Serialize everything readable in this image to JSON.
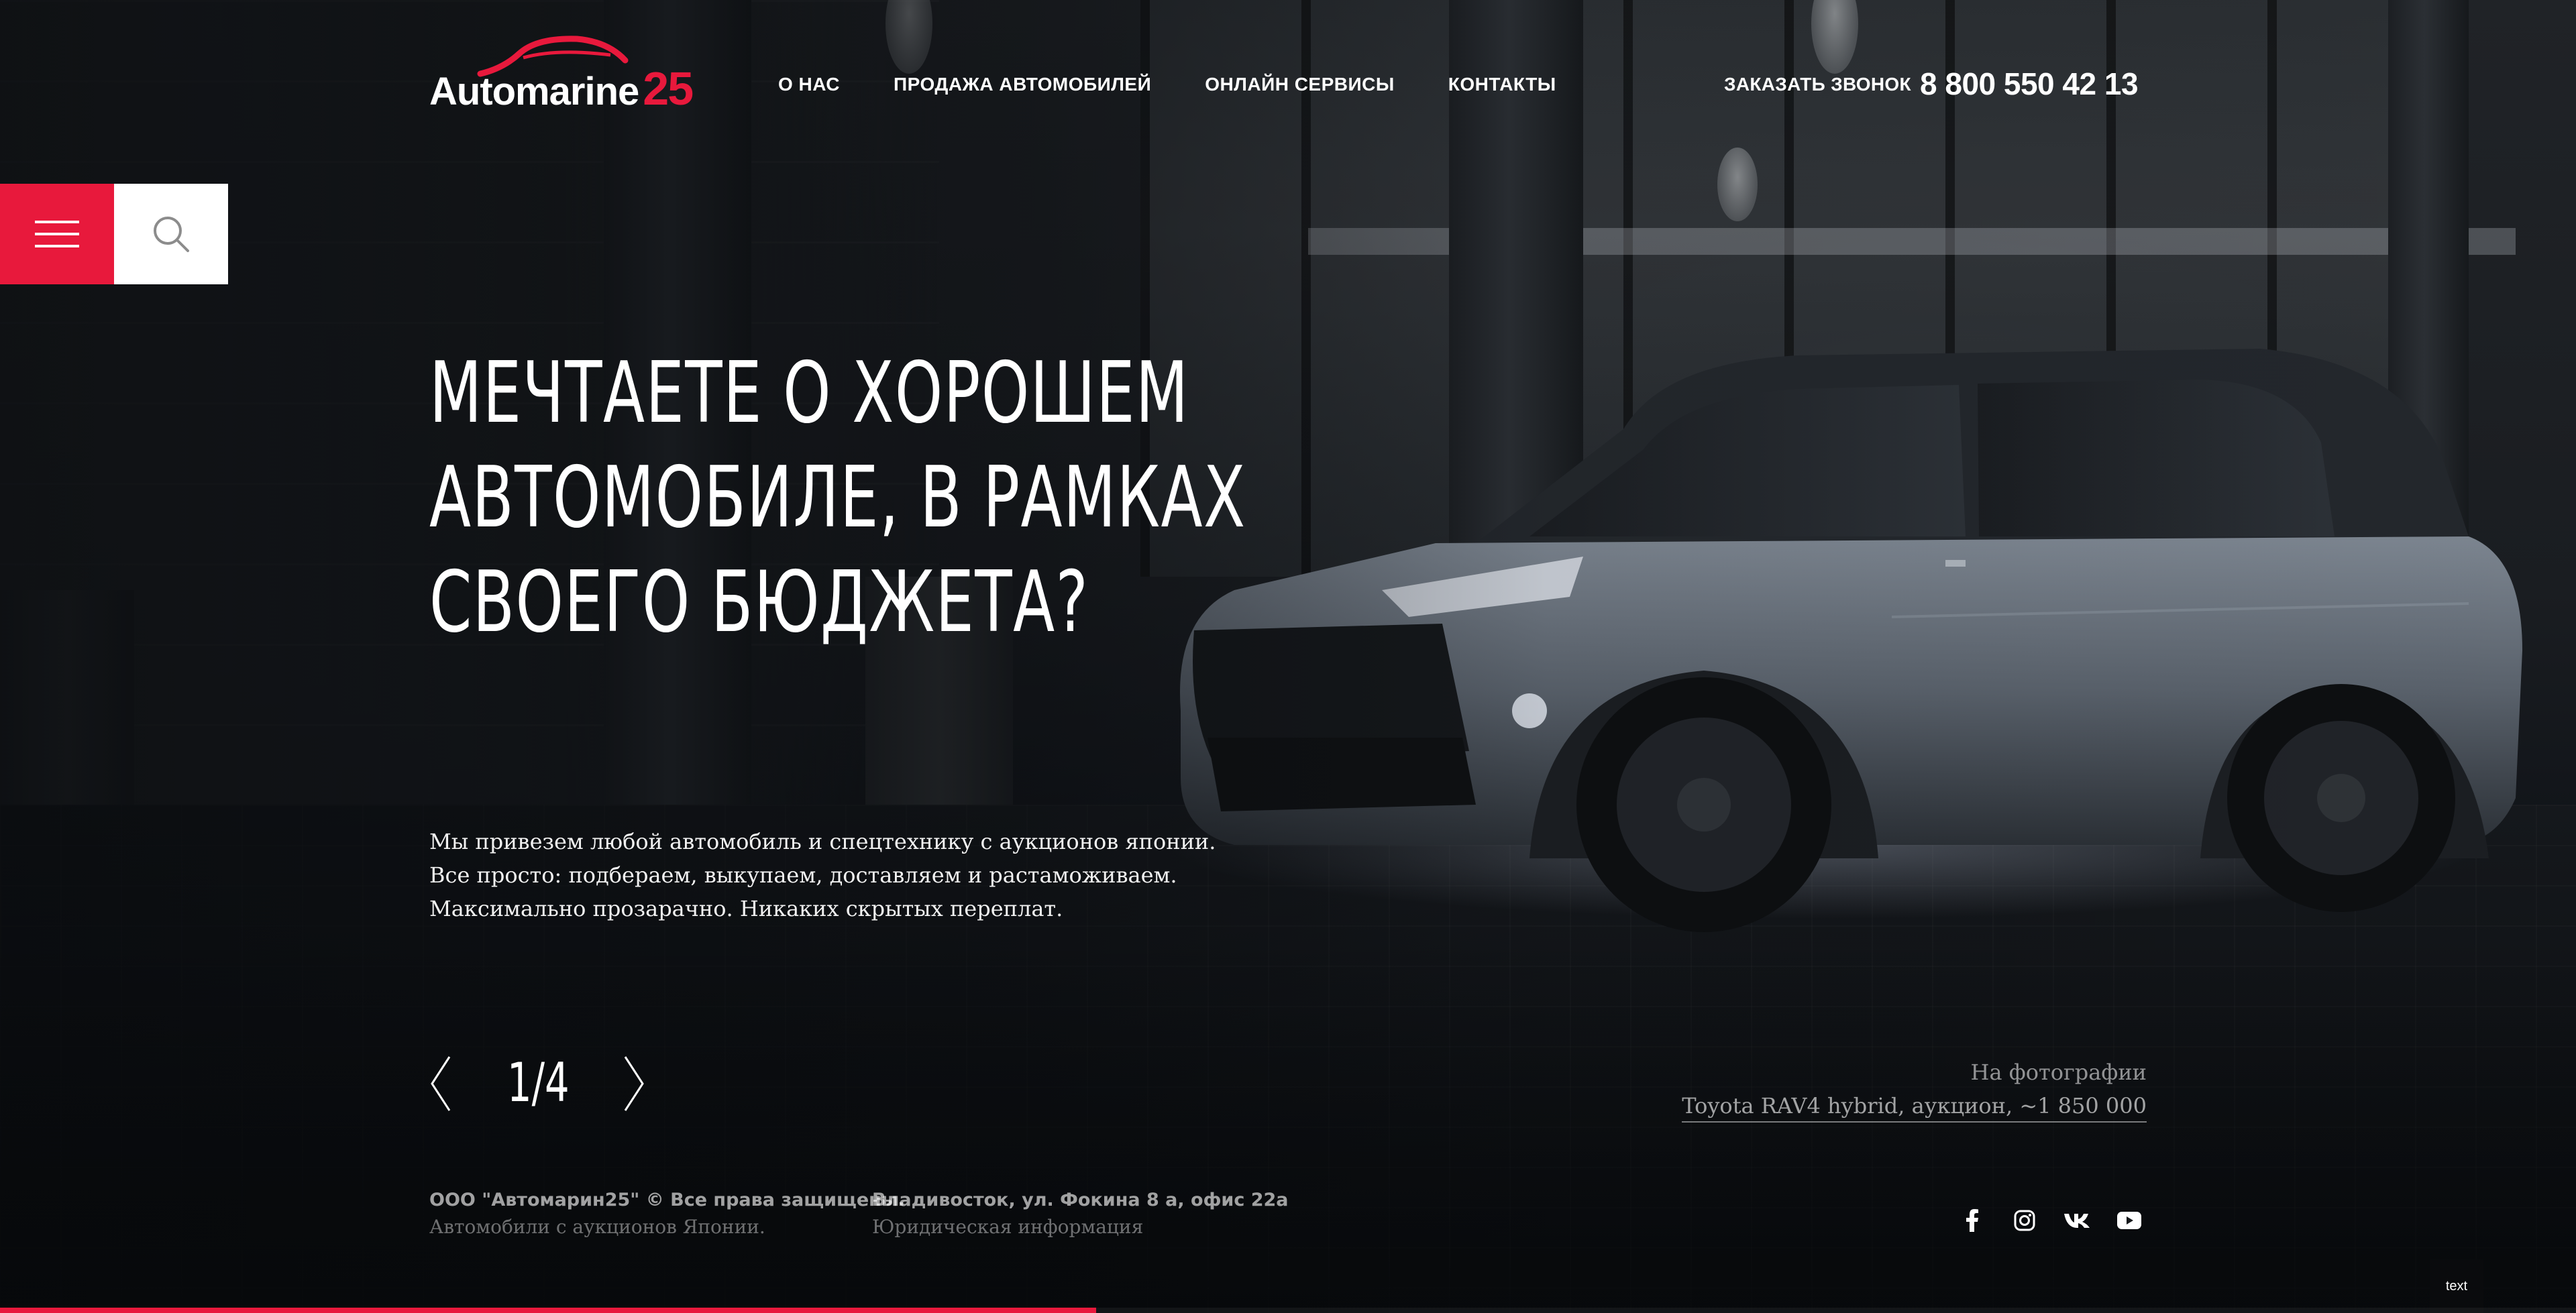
{
  "brand": {
    "name": "Automarine",
    "number": "25",
    "accent": "#e8193c"
  },
  "nav": [
    {
      "label": "О НАС"
    },
    {
      "label": "ПРОДАЖА АВТОМОБИЛЕЙ"
    },
    {
      "label": "ОНЛАЙН СЕРВИСЫ"
    },
    {
      "label": "КОНТАКТЫ"
    }
  ],
  "header": {
    "callback_label": "ЗАКАЗАТЬ ЗВОНОК",
    "phone": "8 800 550 42 13"
  },
  "controls": {
    "menu_icon": "hamburger-icon",
    "search_icon": "search-icon"
  },
  "hero": {
    "title_lines": [
      "МЕЧТАЕТЕ О ХОРОШЕМ",
      "АВТОМОБИЛЕ, В РАМКАХ",
      "СВОЕГО БЮДЖЕТА?"
    ],
    "description_lines": [
      "Мы привезем любой автомобиль и спецтехнику с аукционов японии.",
      "Все просто: подбераем, выкупаем, доставляем и растаможиваем.",
      "Максимально прозарачно. Никаких скрытых переплат."
    ]
  },
  "slider": {
    "counter": "1/4",
    "current": 1,
    "total": 4,
    "progress": 0.4255
  },
  "photo": {
    "caption_label": "На фотографии",
    "caption_link": "Toyota RAV4 hybrid, аукцион, ~1 850 000"
  },
  "footer": {
    "company": "ООО \"Автомарин25\" © Все права защищены.",
    "tagline": "Автомобили с аукционов Японии.",
    "address": "Владивосток, ул. Фокина 8 а, офис 22а",
    "legal_link": "Юридическая информация"
  },
  "socials": [
    {
      "icon": "facebook-icon"
    },
    {
      "icon": "instagram-icon"
    },
    {
      "icon": "vk-icon"
    },
    {
      "icon": "youtube-icon"
    }
  ],
  "chip": {
    "label": "text"
  }
}
